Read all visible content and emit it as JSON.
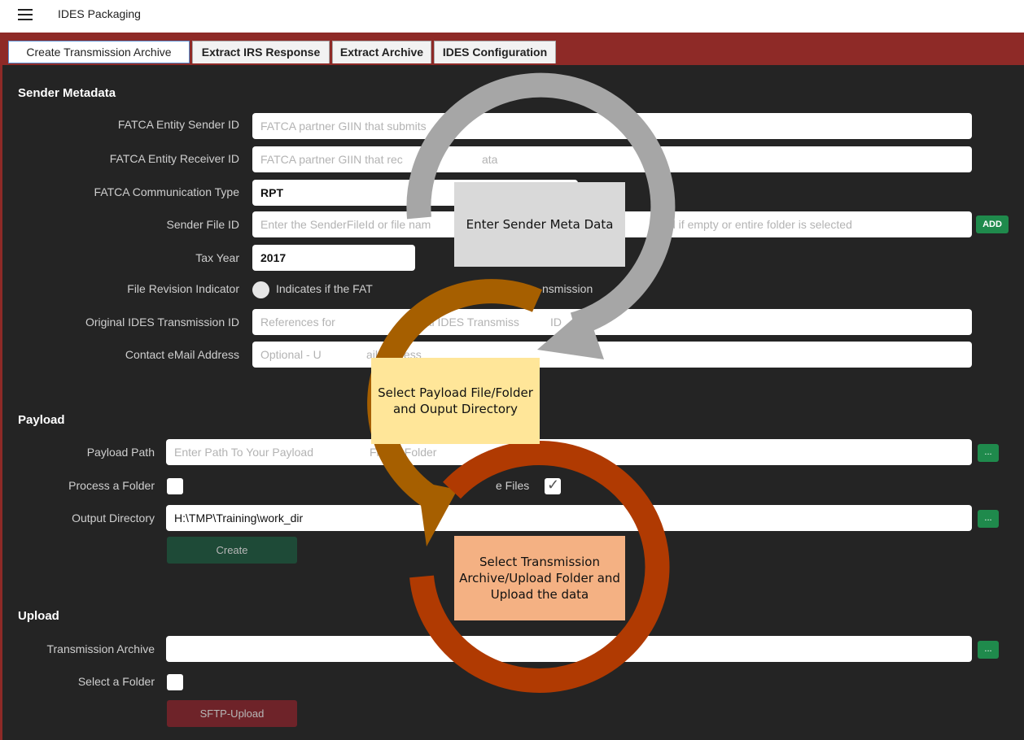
{
  "app": {
    "title": "IDES Packaging"
  },
  "tabs": [
    {
      "label": "Create Transmission Archive"
    },
    {
      "label": "Extract IRS Response"
    },
    {
      "label": "Extract Archive"
    },
    {
      "label": "IDES Configuration"
    }
  ],
  "sender": {
    "section_title": "Sender Metadata",
    "entity_sender_id": {
      "label": "FATCA Entity Sender ID",
      "placeholder": "FATCA partner GIIN that submits"
    },
    "entity_receiver_id": {
      "label": "FATCA Entity Receiver ID",
      "placeholder": "FATCA partner GIIN that rec",
      "placeholder_tail": "ata"
    },
    "communication_type": {
      "label": "FATCA Communication Type",
      "value": "RPT"
    },
    "sender_file_id": {
      "label": "Sender File ID",
      "placeholder": "Enter the SenderFileId or file nam",
      "placeholder_tail": "d if empty or entire folder is selected",
      "add_label": "ADD"
    },
    "tax_year": {
      "label": "Tax Year",
      "value": "2017"
    },
    "file_revision": {
      "label": "File Revision Indicator",
      "text": "Indicates if the FAT",
      "text_tail": "nsmission"
    },
    "original_transmission_id": {
      "label": "Original IDES Transmission ID",
      "placeholder": "References for",
      "placeholder_mid": "ginal IDES Transmiss",
      "placeholder_tail": "ID"
    },
    "contact_email": {
      "label": "Contact eMail Address",
      "placeholder": "Optional - U",
      "placeholder_tail": "ail address"
    }
  },
  "payload": {
    "section_title": "Payload",
    "payload_path": {
      "label": "Payload Path",
      "placeholder": "Enter Path To Your Payload",
      "placeholder_tail": "File or Folder",
      "button": "..."
    },
    "process_folder": {
      "label": "Process a Folder"
    },
    "files_option": {
      "label": "e Files",
      "checked": true
    },
    "output_directory": {
      "label": "Output Directory",
      "value": "H:\\TMP\\Training\\work_dir",
      "button": "..."
    },
    "create_button": "Create"
  },
  "upload": {
    "section_title": "Upload",
    "transmission_archive": {
      "label": "Transmission Archive",
      "button": "..."
    },
    "select_folder": {
      "label": "Select a Folder"
    },
    "sftp_button": "SFTP-Upload"
  },
  "callouts": {
    "step1": "Enter Sender Meta Data",
    "step2": "Select Payload File/Folder and Ouput Directory",
    "step3": "Select Transmission Archive/Upload Folder and Upload the data"
  },
  "colors": {
    "step1_arrow": "#a6a6a6",
    "step1_box": "#d9d9d9",
    "step2_arrow": "#a65f00",
    "step2_box": "#ffe699",
    "step3_arrow": "#b03a02",
    "step3_box": "#f4b183",
    "tab_bar": "#8e2a27",
    "button_green": "#1f8a4c"
  }
}
